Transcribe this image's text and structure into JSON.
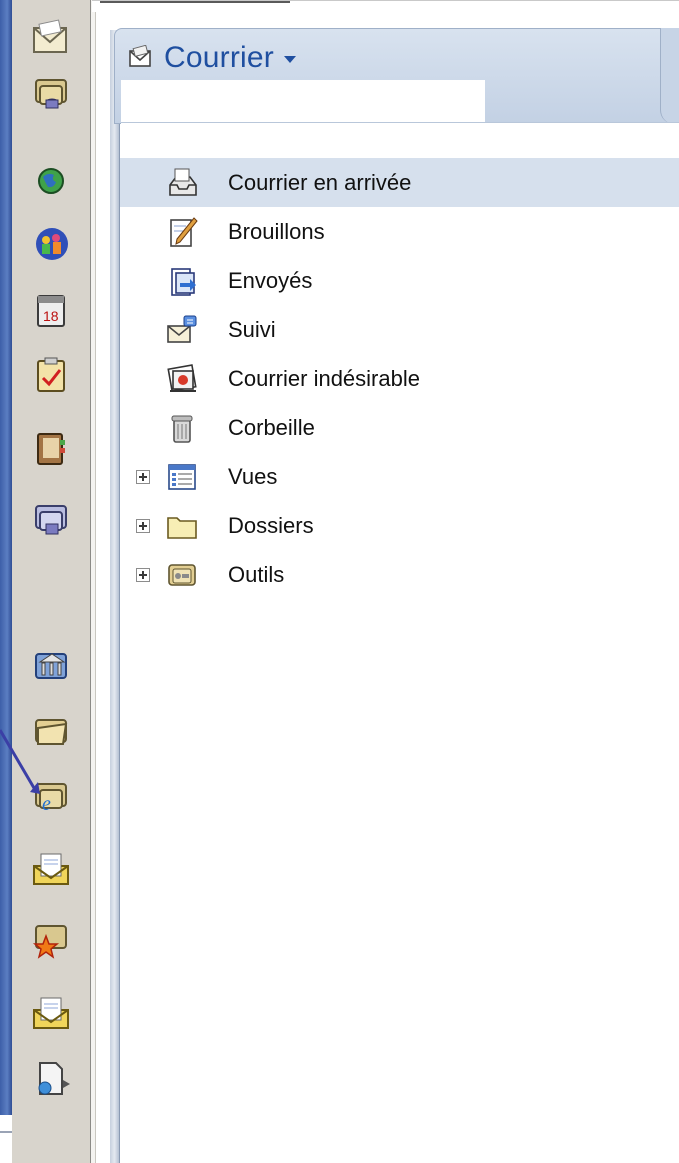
{
  "header": {
    "title": "Courrier"
  },
  "bookmarks": [
    {
      "icon": "mail-envelope-icon"
    },
    {
      "icon": "database-stack-icon"
    },
    {
      "icon": "globe-icon"
    },
    {
      "icon": "people-group-icon"
    },
    {
      "icon": "calendar-icon"
    },
    {
      "icon": "todo-clipboard-icon"
    },
    {
      "icon": "address-book-icon"
    },
    {
      "icon": "replica-database-icon"
    },
    {
      "icon": "library-database-icon"
    },
    {
      "icon": "open-folder-icon"
    },
    {
      "icon": "internet-database-icon"
    },
    {
      "icon": "letter-envelope-icon"
    },
    {
      "icon": "favorites-star-icon"
    },
    {
      "icon": "letter-envelope-2-icon"
    },
    {
      "icon": "document-link-icon"
    }
  ],
  "tree": {
    "items": [
      {
        "label": "Courrier en arrivée",
        "icon": "inbox-tray-icon",
        "selected": true
      },
      {
        "label": "Brouillons",
        "icon": "drafts-pencil-icon"
      },
      {
        "label": "Envoyés",
        "icon": "sent-document-icon"
      },
      {
        "label": "Suivi",
        "icon": "follow-up-envelope-icon"
      },
      {
        "label": "Courrier indésirable",
        "icon": "junk-mail-icon"
      },
      {
        "label": "Corbeille",
        "icon": "trash-can-icon"
      },
      {
        "label": "Vues",
        "icon": "views-list-icon",
        "expandable": true
      },
      {
        "label": "Dossiers",
        "icon": "folder-icon",
        "expandable": true
      },
      {
        "label": "Outils",
        "icon": "tools-box-icon",
        "expandable": true
      }
    ]
  },
  "colors": {
    "accent": "#1f4fa0",
    "selected_row": "#d6e0ed",
    "bookmark_bar": "#d8d4cc",
    "left_edge": "#3d5fa8"
  }
}
